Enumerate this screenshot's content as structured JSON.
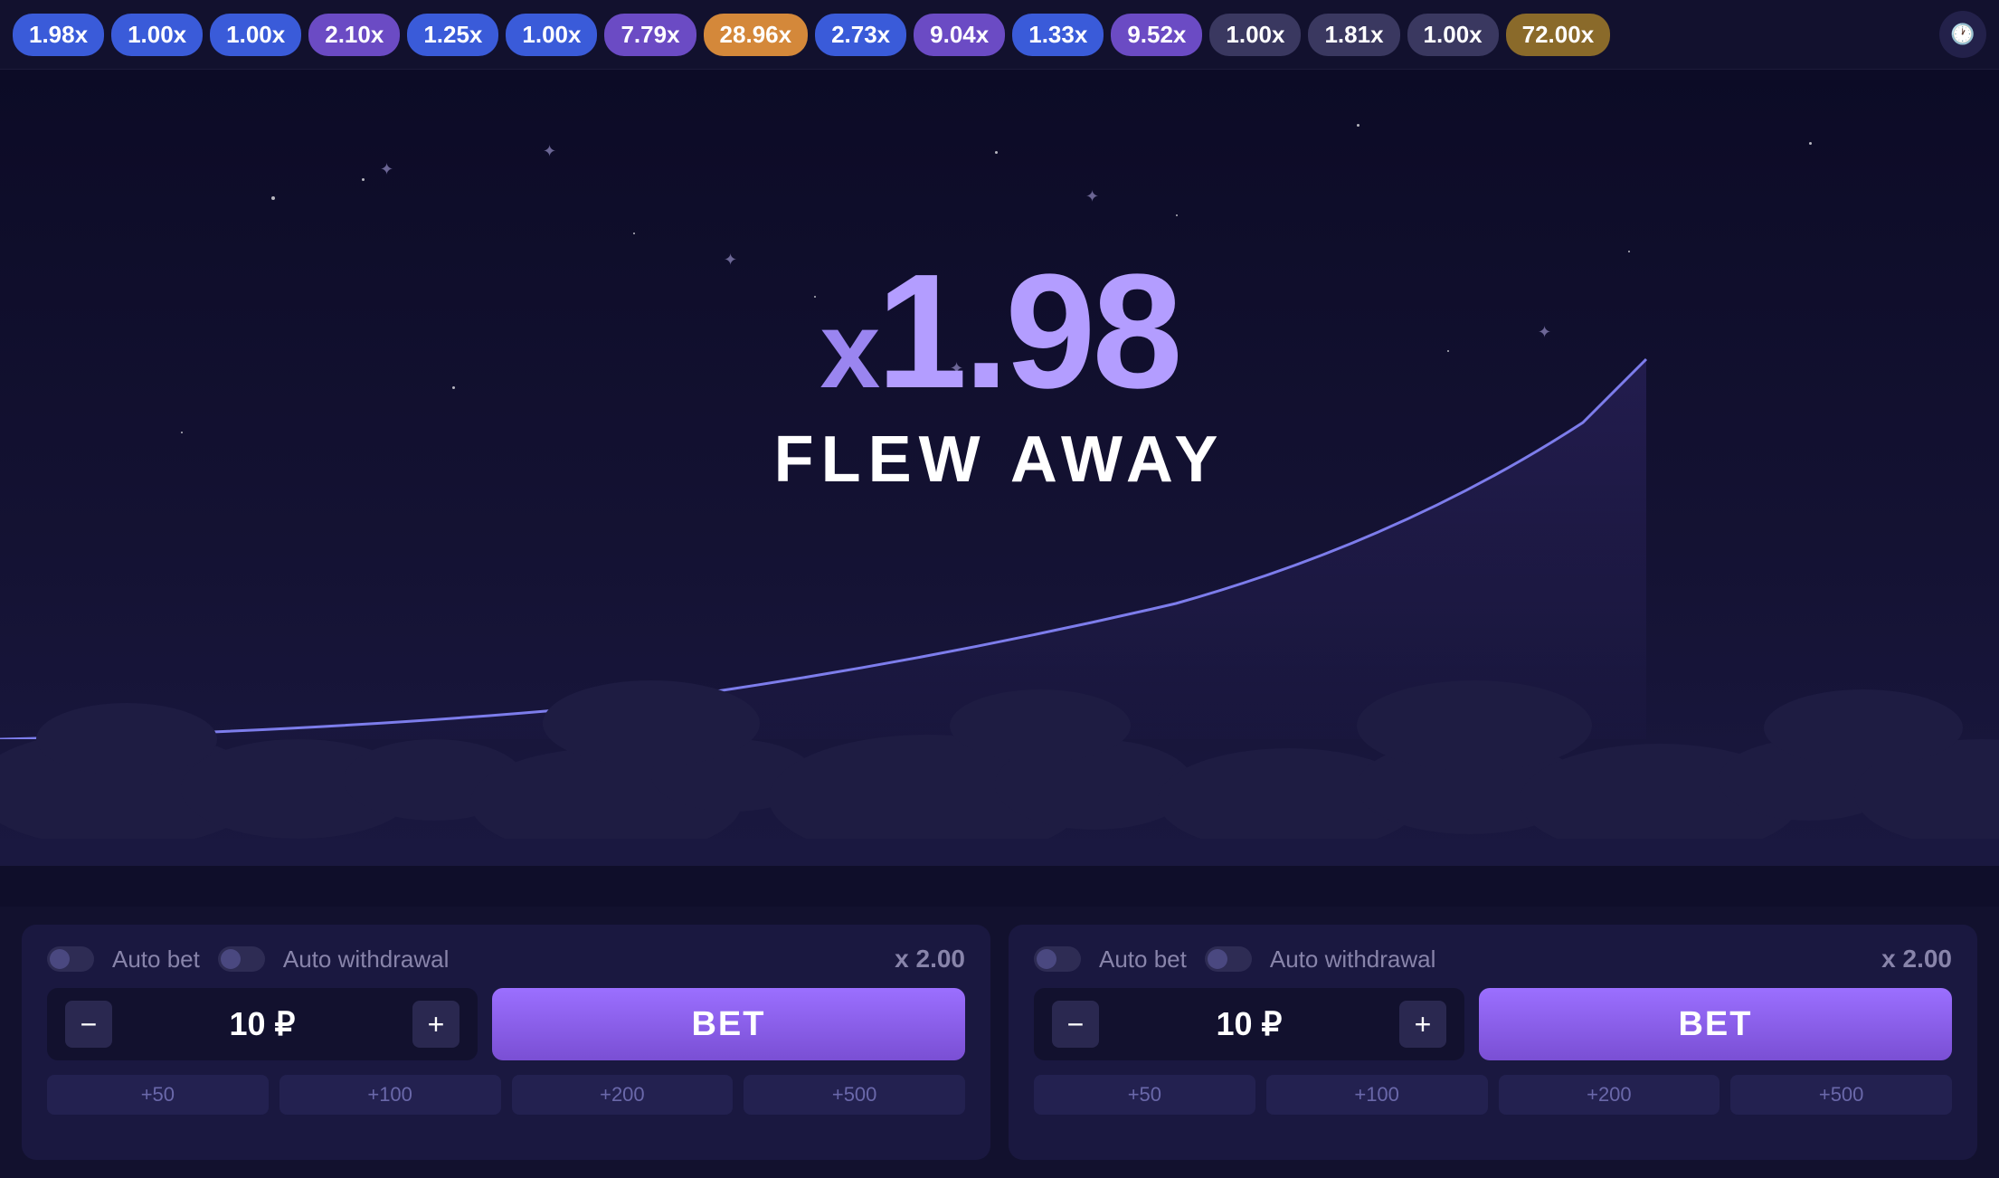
{
  "topbar": {
    "badges": [
      {
        "id": "b1",
        "value": "1.98x",
        "style": "blue"
      },
      {
        "id": "b2",
        "value": "1.00x",
        "style": "blue"
      },
      {
        "id": "b3",
        "value": "1.00x",
        "style": "blue"
      },
      {
        "id": "b4",
        "value": "2.10x",
        "style": "purple"
      },
      {
        "id": "b5",
        "value": "1.25x",
        "style": "blue"
      },
      {
        "id": "b6",
        "value": "1.00x",
        "style": "blue"
      },
      {
        "id": "b7",
        "value": "7.79x",
        "style": "purple"
      },
      {
        "id": "b8",
        "value": "28.96x",
        "style": "orange"
      },
      {
        "id": "b9",
        "value": "2.73x",
        "style": "blue"
      },
      {
        "id": "b10",
        "value": "9.04x",
        "style": "purple"
      },
      {
        "id": "b11",
        "value": "1.33x",
        "style": "blue"
      },
      {
        "id": "b12",
        "value": "9.52x",
        "style": "purple"
      },
      {
        "id": "b13",
        "value": "1.00x",
        "style": "gray"
      },
      {
        "id": "b14",
        "value": "1.81x",
        "style": "gray"
      },
      {
        "id": "b15",
        "value": "1.00x",
        "style": "gray"
      },
      {
        "id": "b16",
        "value": "72.00x",
        "style": "gold"
      }
    ],
    "time_icon": "🕐"
  },
  "game": {
    "multiplier": "1.98",
    "multiplier_prefix": "x",
    "status": "FLEW AWAY"
  },
  "panel_left": {
    "auto_bet_label": "Auto bet",
    "auto_withdrawal_label": "Auto withdrawal",
    "multiplier_x": "x 2.00",
    "bet_amount": "10 ₽",
    "bet_button_label": "BET",
    "quick_adds": [
      "+50",
      "+100",
      "+200",
      "+500"
    ]
  },
  "panel_right": {
    "auto_bet_label": "Auto bet",
    "auto_withdrawal_label": "Auto withdrawal",
    "multiplier_x": "x 2.00",
    "bet_amount": "10 ₽",
    "bet_button_label": "BET",
    "quick_adds": [
      "+50",
      "+100",
      "+200",
      "+500"
    ]
  },
  "colors": {
    "badge_blue": "#3a5bd9",
    "badge_purple": "#6b4bc4",
    "badge_orange": "#d4883a",
    "badge_gray": "#3a3860",
    "badge_gold": "#8a6a2a",
    "multiplier_text": "#b39dff",
    "bet_button_gradient_top": "#9b6fff",
    "bet_button_gradient_bottom": "#7a4fd4"
  }
}
